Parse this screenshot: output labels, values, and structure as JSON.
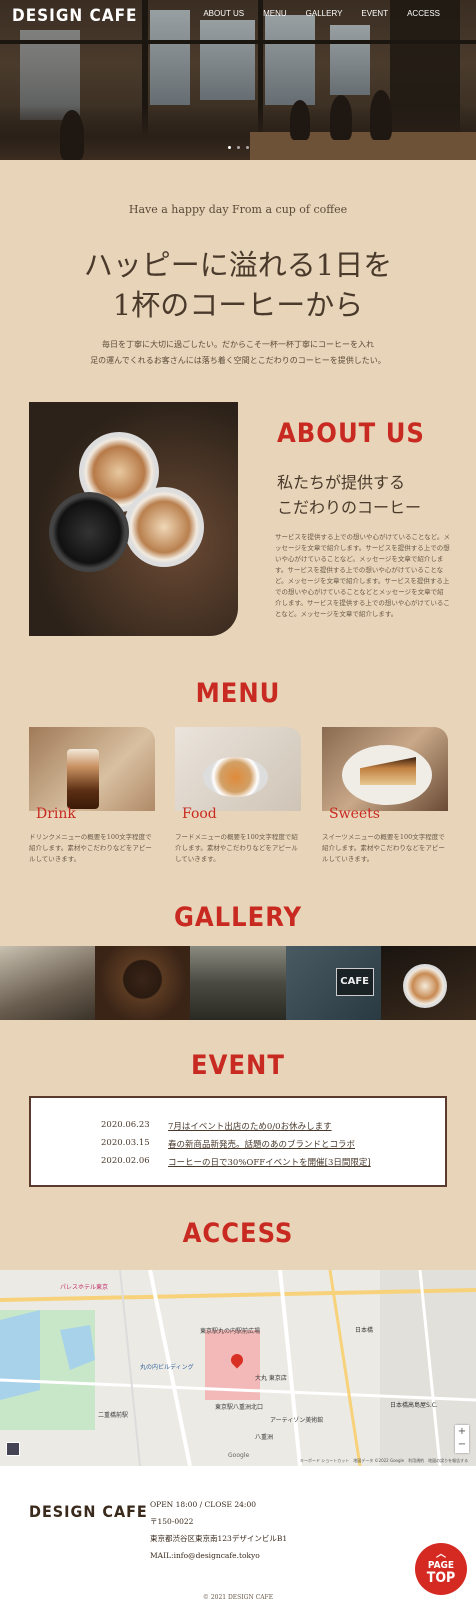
{
  "header": {
    "logo": "DESIGN CAFE",
    "nav": [
      "ABOUT US",
      "MENU",
      "GALLERY",
      "EVENT",
      "ACCESS"
    ]
  },
  "intro": {
    "tagline": "Have a happy day From a cup of coffee",
    "headline_line1": "ハッピーに溢れる1日を",
    "headline_line2": "1杯のコーヒーから",
    "text_line1": "毎日を丁寧に大切に過ごしたい。だからこそ一杯一杯丁寧にコーヒーを入れ",
    "text_line2": "足の運んでくれるお客さんには落ち着く空間とこだわりのコーヒーを提供したい。"
  },
  "about": {
    "title": "ABOUT US",
    "sub_line1": "私たちが提供する",
    "sub_line2": "こだわりのコーヒー",
    "body": "サービスを提供する上での想いや心がけていることなど。メッセージを文章で紹介します。サービスを提供する上での想いや心がけていることなど。メッセージを文章で紹介します。サービスを提供する上での想いや心がけていることなど。メッセージを文章で紹介します。サービスを提供する上での想いや心がけていることなどとメッセージを文章で紹介します。サービスを提供する上での想いや心がけていることなど。メッセージを文章で紹介します。"
  },
  "menu": {
    "title": "MENU",
    "items": [
      {
        "name": "Drink",
        "desc": "ドリンクメニューの概要を100文字程度で紹介します。素材やこだわりなどをアピールしていきます。"
      },
      {
        "name": "Food",
        "desc": "フードメニューの概要を100文字程度で紹介します。素材やこだわりなどをアピールしていきます。"
      },
      {
        "name": "Sweets",
        "desc": "スイーツメニューの概要を100文字程度で紹介します。素材やこだわりなどをアピールしていきます。"
      }
    ]
  },
  "gallery": {
    "title": "GALLERY",
    "sign_text": "CAFE"
  },
  "event": {
    "title": "EVENT",
    "items": [
      {
        "date": "2020.06.23",
        "text": "7月はイベント出店のため0/0お休みします"
      },
      {
        "date": "2020.03.15",
        "text": "春の新商品新発売。話題のあのブランドとコラボ"
      },
      {
        "date": "2020.02.06",
        "text": "コーヒーの日で30%OFFイベントを開催[3日間限定]"
      }
    ]
  },
  "access": {
    "title": "ACCESS",
    "map_labels": [
      "パレスホテル東京",
      "丸の内ビルディング",
      "東京駅丸の内駅前広場",
      "東京駅八重洲北口",
      "日本橋",
      "大丸 東京店",
      "アーティゾン美術館",
      "二重橋前駅",
      "八重洲",
      "日本橋高島屋S.C."
    ],
    "map_credit": "キーボード ショートカット　地図データ ©2022 Google　利用規約　地図の誤りを報告する",
    "google": "Google"
  },
  "footer": {
    "logo": "DESIGN CAFE",
    "hours": "OPEN 18:00 / CLOSE 24:00",
    "zip": "〒150-0022",
    "address": "東京都渋谷区東京南123デザインビルB1",
    "mail": "MAIL:info@designcafe.tokyo",
    "copyright": "© 2021 DESIGN CAFE",
    "pagetop_line1": "PAGE",
    "pagetop_line2": "TOP"
  },
  "colors": {
    "background": "#e8d4b8",
    "accent": "#c82a22",
    "text": "#4a3a2c"
  }
}
